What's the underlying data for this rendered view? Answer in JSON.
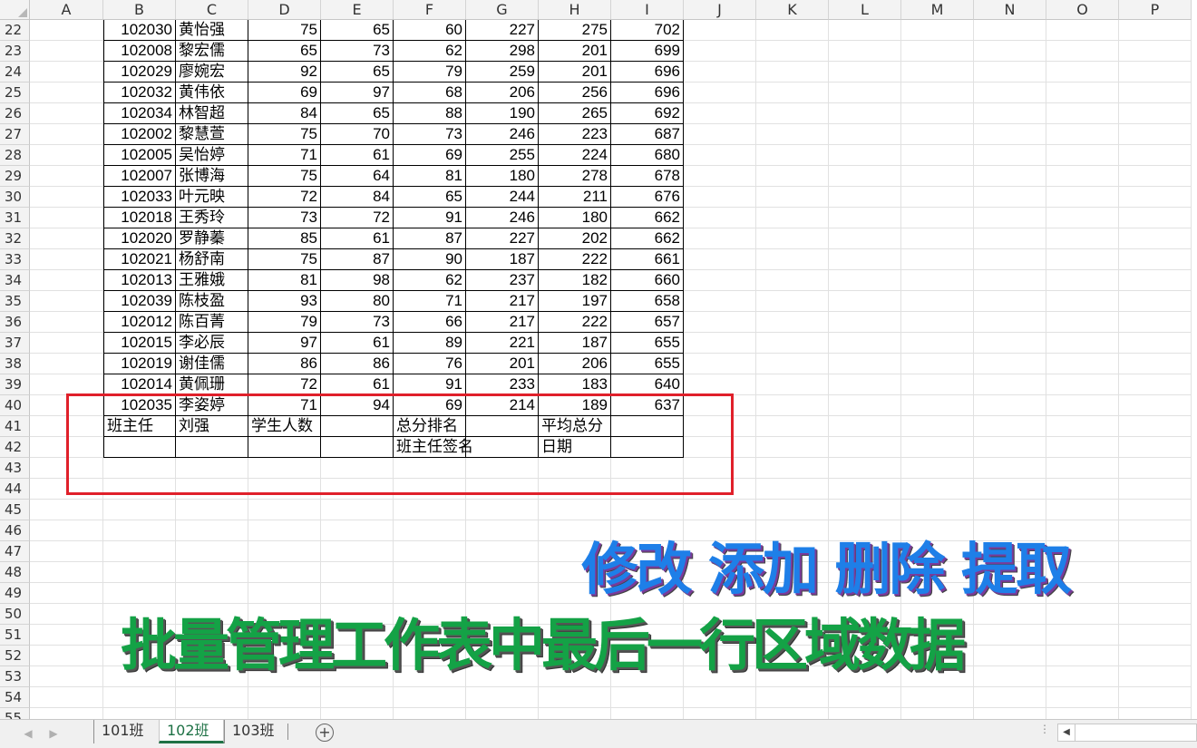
{
  "columns": [
    "A",
    "B",
    "C",
    "D",
    "E",
    "F",
    "G",
    "H",
    "I",
    "J",
    "K",
    "L",
    "M",
    "N",
    "O",
    "P"
  ],
  "row_numbers": [
    "22",
    "23",
    "24",
    "25",
    "26",
    "27",
    "28",
    "29",
    "30",
    "31",
    "32",
    "33",
    "34",
    "35",
    "36",
    "37",
    "38",
    "39",
    "40",
    "41",
    "42",
    "43",
    "44",
    "45",
    "46",
    "47",
    "48",
    "49",
    "50",
    "51",
    "52",
    "53",
    "54",
    "55"
  ],
  "data_rows": [
    [
      "102030",
      "黄怡强",
      "75",
      "65",
      "60",
      "227",
      "275",
      "702"
    ],
    [
      "102008",
      "黎宏儒",
      "65",
      "73",
      "62",
      "298",
      "201",
      "699"
    ],
    [
      "102029",
      "廖婉宏",
      "92",
      "65",
      "79",
      "259",
      "201",
      "696"
    ],
    [
      "102032",
      "黄伟依",
      "69",
      "97",
      "68",
      "206",
      "256",
      "696"
    ],
    [
      "102034",
      "林智超",
      "84",
      "65",
      "88",
      "190",
      "265",
      "692"
    ],
    [
      "102002",
      "黎慧萱",
      "75",
      "70",
      "73",
      "246",
      "223",
      "687"
    ],
    [
      "102005",
      "吴怡婷",
      "71",
      "61",
      "69",
      "255",
      "224",
      "680"
    ],
    [
      "102007",
      "张博海",
      "75",
      "64",
      "81",
      "180",
      "278",
      "678"
    ],
    [
      "102033",
      "叶元映",
      "72",
      "84",
      "65",
      "244",
      "211",
      "676"
    ],
    [
      "102018",
      "王秀玲",
      "73",
      "72",
      "91",
      "246",
      "180",
      "662"
    ],
    [
      "102020",
      "罗静蓁",
      "85",
      "61",
      "87",
      "227",
      "202",
      "662"
    ],
    [
      "102021",
      "杨舒南",
      "75",
      "87",
      "90",
      "187",
      "222",
      "661"
    ],
    [
      "102013",
      "王雅娥",
      "81",
      "98",
      "62",
      "237",
      "182",
      "660"
    ],
    [
      "102039",
      "陈枝盈",
      "93",
      "80",
      "71",
      "217",
      "197",
      "658"
    ],
    [
      "102012",
      "陈百菁",
      "79",
      "73",
      "66",
      "217",
      "222",
      "657"
    ],
    [
      "102015",
      "李必辰",
      "97",
      "61",
      "89",
      "221",
      "187",
      "655"
    ],
    [
      "102019",
      "谢佳儒",
      "86",
      "86",
      "76",
      "201",
      "206",
      "655"
    ],
    [
      "102014",
      "黄佩珊",
      "72",
      "61",
      "91",
      "233",
      "183",
      "640"
    ],
    [
      "102035",
      "李姿婷",
      "71",
      "94",
      "69",
      "214",
      "189",
      "637"
    ]
  ],
  "footer_row1": [
    "班主任",
    "刘强",
    "学生人数",
    "",
    "总分排名",
    "",
    "平均总分",
    ""
  ],
  "footer_row2": [
    "",
    "",
    "",
    "",
    "班主任签名",
    "",
    "日期",
    ""
  ],
  "overlay": {
    "line1": "修改 添加 删除 提取",
    "line2": "批量管理工作表中最后一行区域数据"
  },
  "sheet_tabs": [
    {
      "label": "101班",
      "active": false
    },
    {
      "label": "102班",
      "active": true
    },
    {
      "label": "103班",
      "active": false
    }
  ],
  "add_sheet_icon": "plus-circle",
  "colors": {
    "red_box": "#e0202a",
    "overlay_blue": "#1e7fe8",
    "overlay_green": "#14a246",
    "active_tab": "#1e7145"
  }
}
